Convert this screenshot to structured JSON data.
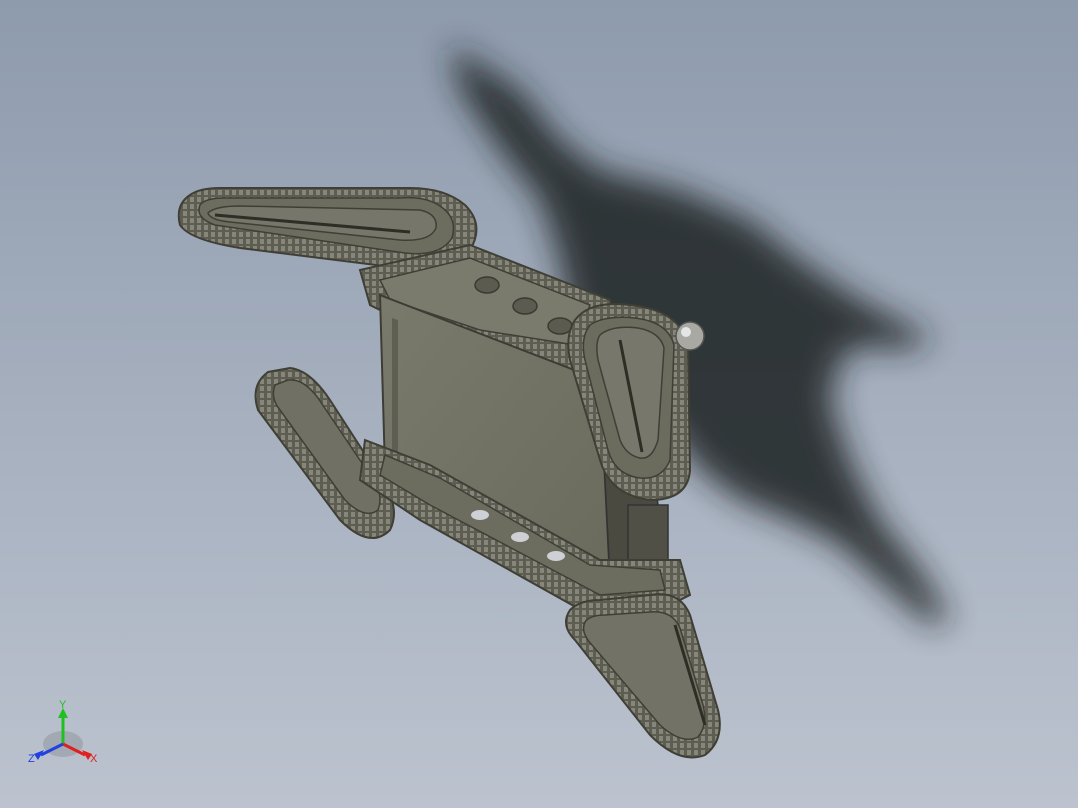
{
  "scene": {
    "background": {
      "top": "#8e9bad",
      "bottom": "#bcc3cf"
    },
    "model_color": "#6f6f62",
    "model_dark": "#4a4a40",
    "model_light": "#8a8a7c",
    "shadow_color": "#1f2023"
  },
  "triad": {
    "x_label": "X",
    "y_label": "Y",
    "z_label": "Z",
    "x_color": "#e02020",
    "y_color": "#20c020",
    "z_color": "#2040e0"
  }
}
